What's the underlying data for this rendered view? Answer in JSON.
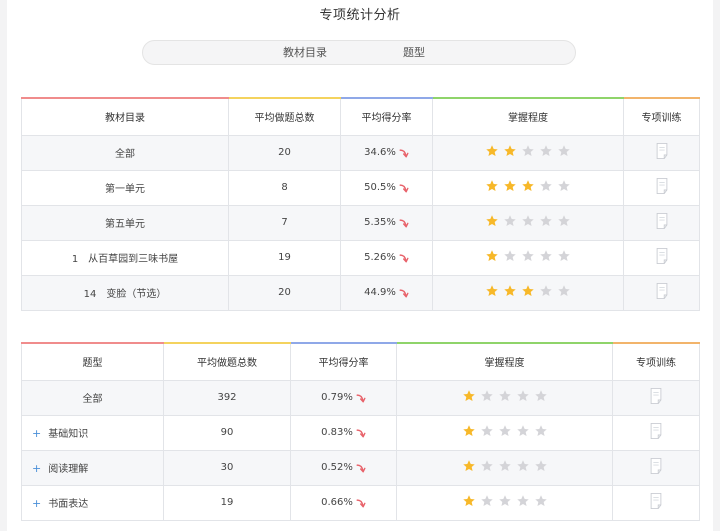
{
  "page_title": "专项统计分析",
  "tabs": [
    {
      "label": "教材目录"
    },
    {
      "label": "题型"
    }
  ],
  "colors": {
    "star_on": "#f7b829",
    "star_off": "#d4d4d8",
    "trend_arrow": "#e8626a"
  },
  "table1": {
    "headers": [
      "教材目录",
      "平均做题总数",
      "平均得分率",
      "掌握程度",
      "专项训练"
    ],
    "rows": [
      {
        "name": "全部",
        "count": "20",
        "rate": "34.6%",
        "stars": 2
      },
      {
        "name": "第一单元",
        "count": "8",
        "rate": "50.5%",
        "stars": 3
      },
      {
        "name": "第五单元",
        "count": "7",
        "rate": "5.35%",
        "stars": 1
      },
      {
        "name": "1　从百草园到三味书屋",
        "count": "19",
        "rate": "5.26%",
        "stars": 1
      },
      {
        "name": "14　变脸（节选）",
        "count": "20",
        "rate": "44.9%",
        "stars": 3
      }
    ]
  },
  "table2": {
    "headers": [
      "题型",
      "平均做题总数",
      "平均得分率",
      "掌握程度",
      "专项训练"
    ],
    "rows": [
      {
        "name": "全部",
        "expandable": false,
        "count": "392",
        "rate": "0.79%",
        "stars": 1
      },
      {
        "name": "基础知识",
        "expandable": true,
        "count": "90",
        "rate": "0.83%",
        "stars": 1
      },
      {
        "name": "阅读理解",
        "expandable": true,
        "count": "30",
        "rate": "0.52%",
        "stars": 1
      },
      {
        "name": "书面表达",
        "expandable": true,
        "count": "19",
        "rate": "0.66%",
        "stars": 1
      }
    ],
    "expand_glyph": "+"
  },
  "icons": {
    "trend": "trend-down-icon",
    "star": "star-icon",
    "training": "training-document-icon"
  }
}
